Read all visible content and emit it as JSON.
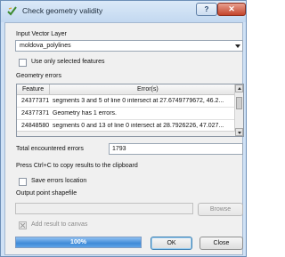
{
  "window": {
    "title": "Check geometry validity",
    "help_icon": "question-icon",
    "close_icon": "close-icon"
  },
  "input_layer": {
    "label": "Input Vector Layer",
    "selected": "moldova_polylines"
  },
  "selected_features": {
    "label": "Use only selected features",
    "checked": false
  },
  "errors": {
    "label": "Geometry errors",
    "columns": [
      "Feature",
      "Error(s)"
    ],
    "rows": [
      {
        "feature": "24377371",
        "error": "segments 3 and 5 of line 0 intersect at 27.6749779672, 46.2..."
      },
      {
        "feature": "24377371",
        "error": "Geometry has 1 errors."
      },
      {
        "feature": "24848580",
        "error": "segments 0 and 13 of line 0 intersect at 28.7926226, 47.027..."
      }
    ]
  },
  "total": {
    "label": "Total encountered errors",
    "value": "1793"
  },
  "hint": "Press Ctrl+C to copy results to the clipboard",
  "save_location": {
    "label": "Save errors location",
    "checked": false
  },
  "output": {
    "label": "Output point shapefile",
    "value": "",
    "browse_label": "Browse"
  },
  "add_to_canvas": {
    "label": "Add result to canvas",
    "checked": true,
    "enabled": false
  },
  "progress": {
    "value": 1.0,
    "text": "100%"
  },
  "buttons": {
    "ok": "OK",
    "close": "Close"
  },
  "colors": {
    "progress": "#3f8ad7",
    "titlebar": "#c3d8f0"
  }
}
